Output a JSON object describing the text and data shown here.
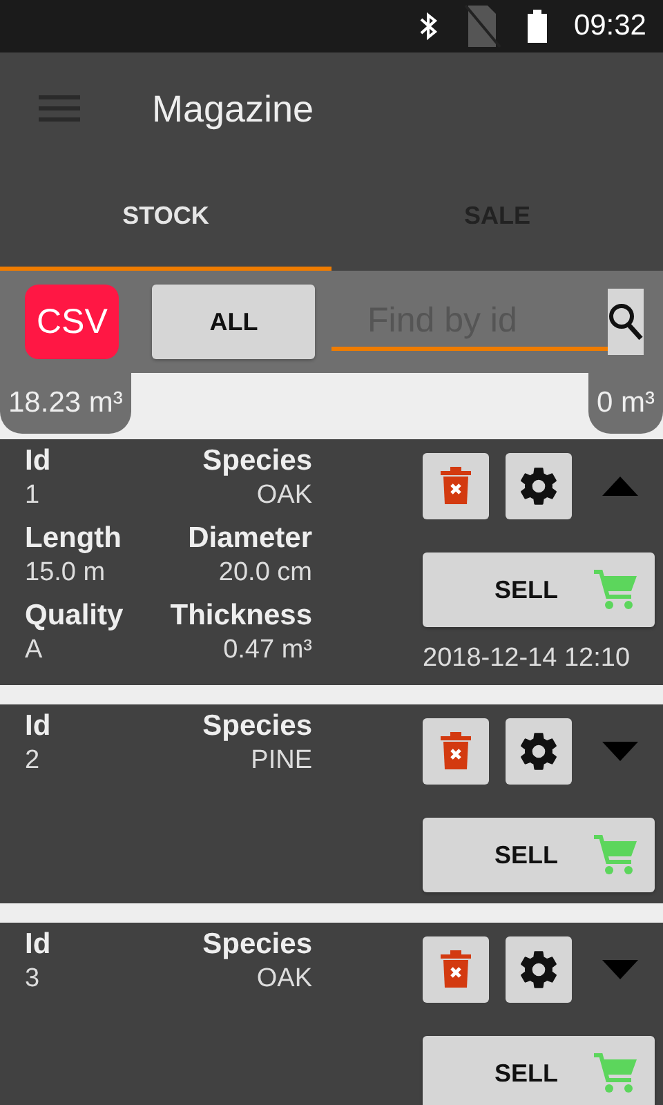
{
  "status_bar": {
    "time": "09:32"
  },
  "app_bar": {
    "title": "Magazine"
  },
  "tabs": [
    {
      "label": "STOCK",
      "selected": true
    },
    {
      "label": "SALE",
      "selected": false
    }
  ],
  "toolbar": {
    "csv_button": "CSV",
    "filter_button": "ALL",
    "search": {
      "placeholder": "Find by id"
    }
  },
  "totals": {
    "left": "18.23 m³",
    "right": "0 m³"
  },
  "items": [
    {
      "expanded": true,
      "fields": [
        {
          "label": "Id",
          "value": "1"
        },
        {
          "label": "Species",
          "value": "OAK"
        },
        {
          "label": "Length",
          "value": "15.0 m"
        },
        {
          "label": "Diameter",
          "value": "20.0 cm"
        },
        {
          "label": "Quality",
          "value": "A"
        },
        {
          "label": "Thickness",
          "value": "0.47 m³"
        }
      ],
      "sell_button": "SELL",
      "date": "2018-12-14 12:10"
    },
    {
      "expanded": false,
      "fields": [
        {
          "label": "Id",
          "value": "2"
        },
        {
          "label": "Species",
          "value": "PINE"
        }
      ],
      "sell_button": "SELL"
    },
    {
      "expanded": false,
      "fields": [
        {
          "label": "Id",
          "value": "3"
        },
        {
          "label": "Species",
          "value": "OAK"
        }
      ],
      "sell_button": "SELL"
    }
  ]
}
